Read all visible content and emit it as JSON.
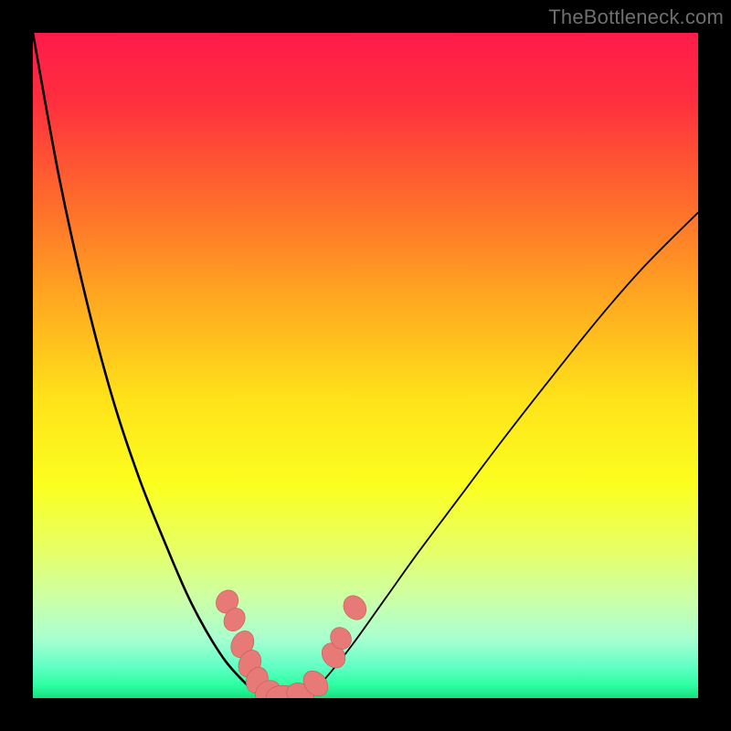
{
  "watermark": "TheBottleneck.com",
  "chart_data": {
    "type": "line",
    "title": "",
    "xlabel": "",
    "ylabel": "",
    "xlim": [
      0,
      100
    ],
    "ylim": [
      0,
      100
    ],
    "grid": false,
    "legend": false,
    "gradient_stops": [
      {
        "pct": 0,
        "color": "#ff1b4a"
      },
      {
        "pct": 10,
        "color": "#ff2e3f"
      },
      {
        "pct": 25,
        "color": "#ff6a2c"
      },
      {
        "pct": 42,
        "color": "#ffb01f"
      },
      {
        "pct": 55,
        "color": "#ffe21a"
      },
      {
        "pct": 68,
        "color": "#fbff1f"
      },
      {
        "pct": 78,
        "color": "#e6ff68"
      },
      {
        "pct": 85,
        "color": "#ccffa6"
      },
      {
        "pct": 91,
        "color": "#a9ffd0"
      },
      {
        "pct": 95,
        "color": "#66ffc7"
      },
      {
        "pct": 98,
        "color": "#2dffa3"
      },
      {
        "pct": 100,
        "color": "#17e07f"
      }
    ],
    "series": [
      {
        "name": "left_curve",
        "x": [
          0,
          4,
          8,
          12,
          16,
          20,
          23,
          25,
          27,
          29,
          31,
          33,
          35
        ],
        "values": [
          100,
          78,
          60,
          45,
          33,
          23,
          16,
          12,
          8.5,
          5.5,
          3.2,
          1.3,
          0
        ]
      },
      {
        "name": "floor",
        "x": [
          35,
          41
        ],
        "values": [
          0,
          0
        ]
      },
      {
        "name": "right_curve",
        "x": [
          41,
          44,
          48,
          53,
          58,
          64,
          70,
          77,
          85,
          92,
          100
        ],
        "values": [
          0,
          3,
          8,
          15,
          22,
          30,
          38,
          47,
          57,
          65,
          73
        ]
      }
    ],
    "markers": [
      {
        "x": 29.2,
        "y": 14.5,
        "rx": 1.8,
        "ry": 1.6,
        "rot": -55
      },
      {
        "x": 30.3,
        "y": 11.8,
        "rx": 1.8,
        "ry": 1.5,
        "rot": -58
      },
      {
        "x": 31.5,
        "y": 8.1,
        "rx": 2.1,
        "ry": 1.6,
        "rot": -62
      },
      {
        "x": 32.6,
        "y": 5.2,
        "rx": 2.1,
        "ry": 1.6,
        "rot": -65
      },
      {
        "x": 33.7,
        "y": 2.7,
        "rx": 2.0,
        "ry": 1.6,
        "rot": -70
      },
      {
        "x": 35.3,
        "y": 0.9,
        "rx": 2.0,
        "ry": 1.6,
        "rot": -38
      },
      {
        "x": 37.6,
        "y": 0.3,
        "rx": 2.5,
        "ry": 1.6,
        "rot": 0
      },
      {
        "x": 40.2,
        "y": 0.6,
        "rx": 2.1,
        "ry": 1.6,
        "rot": 20
      },
      {
        "x": 42.5,
        "y": 2.2,
        "rx": 2.1,
        "ry": 1.6,
        "rot": 48
      },
      {
        "x": 45.2,
        "y": 6.4,
        "rx": 2.0,
        "ry": 1.6,
        "rot": 52
      },
      {
        "x": 46.3,
        "y": 9.0,
        "rx": 1.7,
        "ry": 1.5,
        "rot": 54
      },
      {
        "x": 48.4,
        "y": 13.6,
        "rx": 1.9,
        "ry": 1.6,
        "rot": 55
      }
    ],
    "marker_fill": "#e77a76",
    "marker_stroke": "#c45a56",
    "curve_stroke": "#000000",
    "curve_width_left": 2.6,
    "curve_width_right": 1.8
  }
}
